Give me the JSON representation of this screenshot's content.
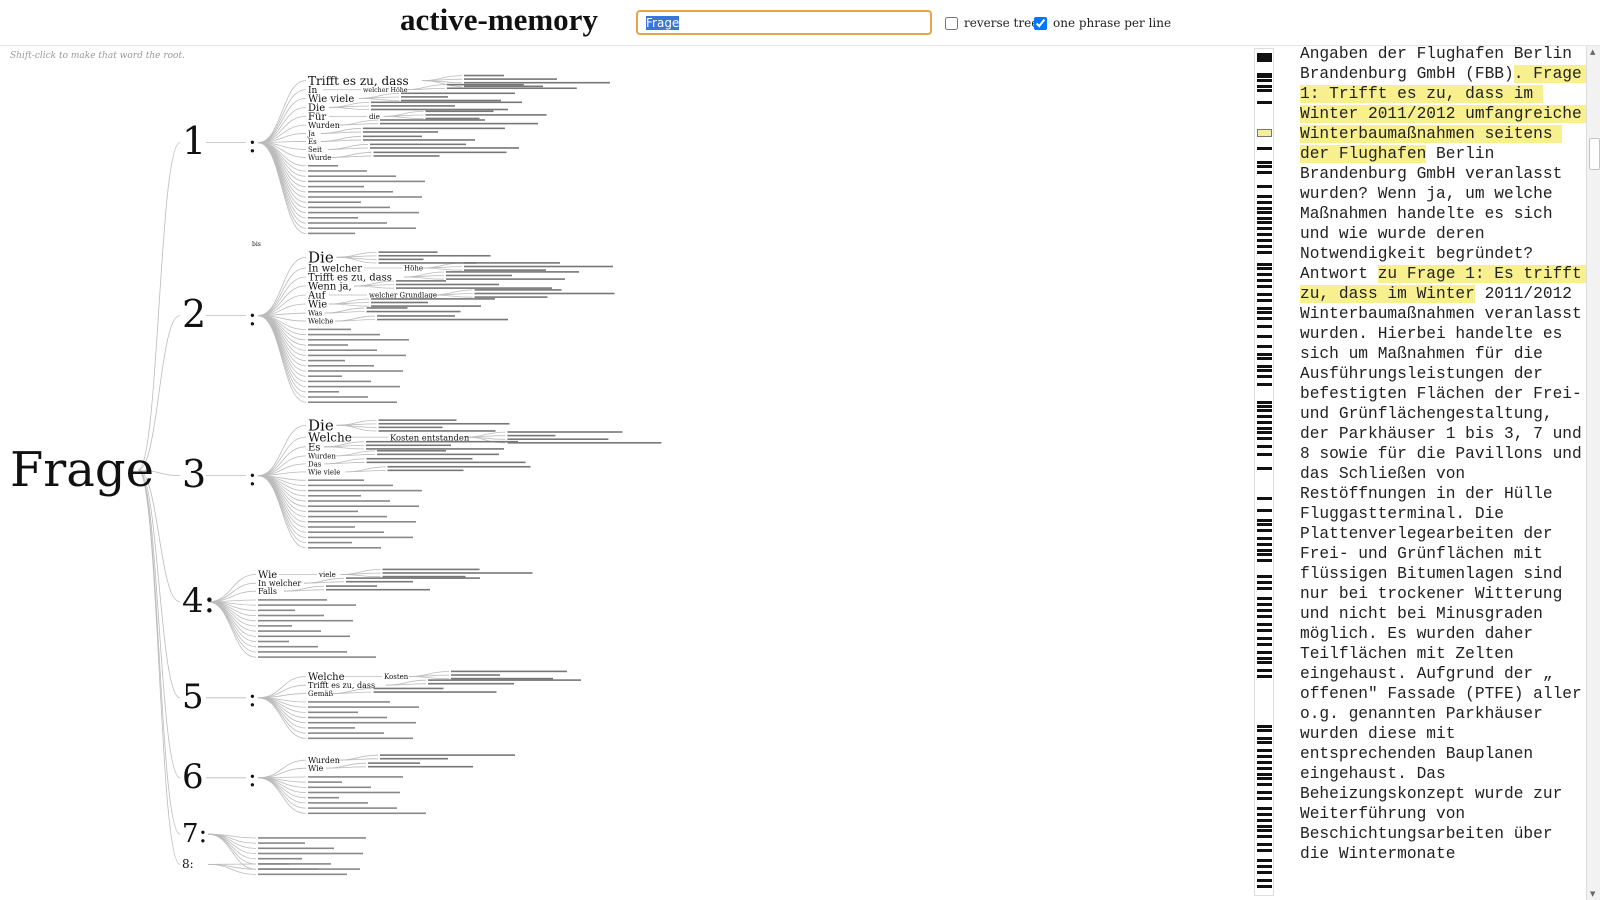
{
  "header": {
    "title": "active-memory",
    "search": {
      "value": "Frage"
    },
    "options": [
      {
        "label": "reverse tree",
        "checked": false
      },
      {
        "label": "one phrase per line",
        "checked": true
      }
    ]
  },
  "hint": "Shift-click to make that word the root.",
  "tree": {
    "root": "Frage",
    "branches": [
      {
        "number": "1",
        "sep": ":",
        "children": [
          {
            "label": "Trifft es zu, dass",
            "size": 12
          },
          {
            "label": "In",
            "size": 9,
            "sub": "welcher Höhe"
          },
          {
            "label": "Wie viele",
            "size": 10
          },
          {
            "label": "Die",
            "size": 10
          },
          {
            "label": "Für",
            "size": 10,
            "sub": "die"
          },
          {
            "label": "Wurden",
            "size": 8
          },
          {
            "label": "Ja",
            "size": 7
          },
          {
            "label": "Es",
            "size": 7
          },
          {
            "label": "Seit",
            "size": 7
          },
          {
            "label": "Wurde",
            "size": 7
          }
        ],
        "extra": "bis"
      },
      {
        "number": "2",
        "sep": ":",
        "children": [
          {
            "label": "Die",
            "size": 15
          },
          {
            "label": "In welcher",
            "size": 10,
            "sub": "Höhe"
          },
          {
            "label": "Trifft es zu, dass",
            "size": 10
          },
          {
            "label": "Wenn ja,",
            "size": 10
          },
          {
            "label": "Auf",
            "size": 10,
            "sub": "welcher Grundlage"
          },
          {
            "label": "Wie",
            "size": 10
          },
          {
            "label": "Was",
            "size": 7
          },
          {
            "label": "Welche",
            "size": 7
          }
        ]
      },
      {
        "number": "3",
        "sep": ":",
        "children": [
          {
            "label": "Die",
            "size": 15
          },
          {
            "label": "Welche",
            "size": 12,
            "sub": "Kosten entstanden"
          },
          {
            "label": "Es",
            "size": 10
          },
          {
            "label": "Wurden",
            "size": 7
          },
          {
            "label": "Das",
            "size": 7
          },
          {
            "label": "Wie viele",
            "size": 7
          }
        ]
      },
      {
        "number": "4:",
        "sep": "",
        "children": [
          {
            "label": "Wie",
            "size": 10,
            "sub": "viele"
          },
          {
            "label": "In welcher",
            "size": 8
          },
          {
            "label": "Falls",
            "size": 8
          }
        ]
      },
      {
        "number": "5",
        "sep": ":",
        "children": [
          {
            "label": "Welche",
            "size": 10,
            "sub": "Kosten"
          },
          {
            "label": "Trifft es zu, dass",
            "size": 8
          },
          {
            "label": "Gemäß",
            "size": 7
          }
        ]
      },
      {
        "number": "6",
        "sep": ":",
        "children": [
          {
            "label": "Wurden",
            "size": 8
          },
          {
            "label": "Wie",
            "size": 8
          }
        ]
      },
      {
        "number": "7:",
        "sep": "",
        "children": []
      },
      {
        "number": "8:",
        "sep": "",
        "children": []
      }
    ]
  },
  "reader": {
    "segments": [
      {
        "text": "Angaben der Flughafen Berlin Brandenburg GmbH (FBB)",
        "hl": false
      },
      {
        "text": ". Frage 1: Trifft es zu, dass im Winter 2011/2012 umfangreiche Winterbaumaßnahmen seitens der Flughafen",
        "hl": true
      },
      {
        "text": " Berlin Brandenburg GmbH veranlasst wurden? Wenn ja, um welche Maßnahmen handelte es sich und wie wurde deren Notwendigkeit begründet? Antwort ",
        "hl": false
      },
      {
        "text": "zu Frage 1: Es trifft zu, dass im Winter",
        "hl": true
      },
      {
        "text": " 2011/2012 Winterbaumaßnahmen veranlasst wurden. Hierbei handelte es sich um Maßnahmen für die Ausführungsleistungen der befestigten Flächen der Frei- und Grünflächengestaltung, der Parkhäuser 1 bis 3, 7 und 8 sowie für die Pavillons und das Schließen von Restöffnungen in der Hülle Fluggastterminal. Die Plattenverlegearbeiten der Frei- und Grünflächen mit flüssigen Bitumenlagen sind nur bei trockener Witterung und nicht bei Minusgraden möglich. Es wurden daher Teilflächen mit Zelten eingehaust. Aufgrund der „ offenen\" Fassade (PTFE) aller o.g. genannten Parkhäuser wurden diese mit entsprechenden Bauplanen eingehaust. Das Beheizungskonzept wurde zur Weiterführung von Beschichtungsarbeiten über die Wintermonate",
        "hl": false
      }
    ]
  }
}
